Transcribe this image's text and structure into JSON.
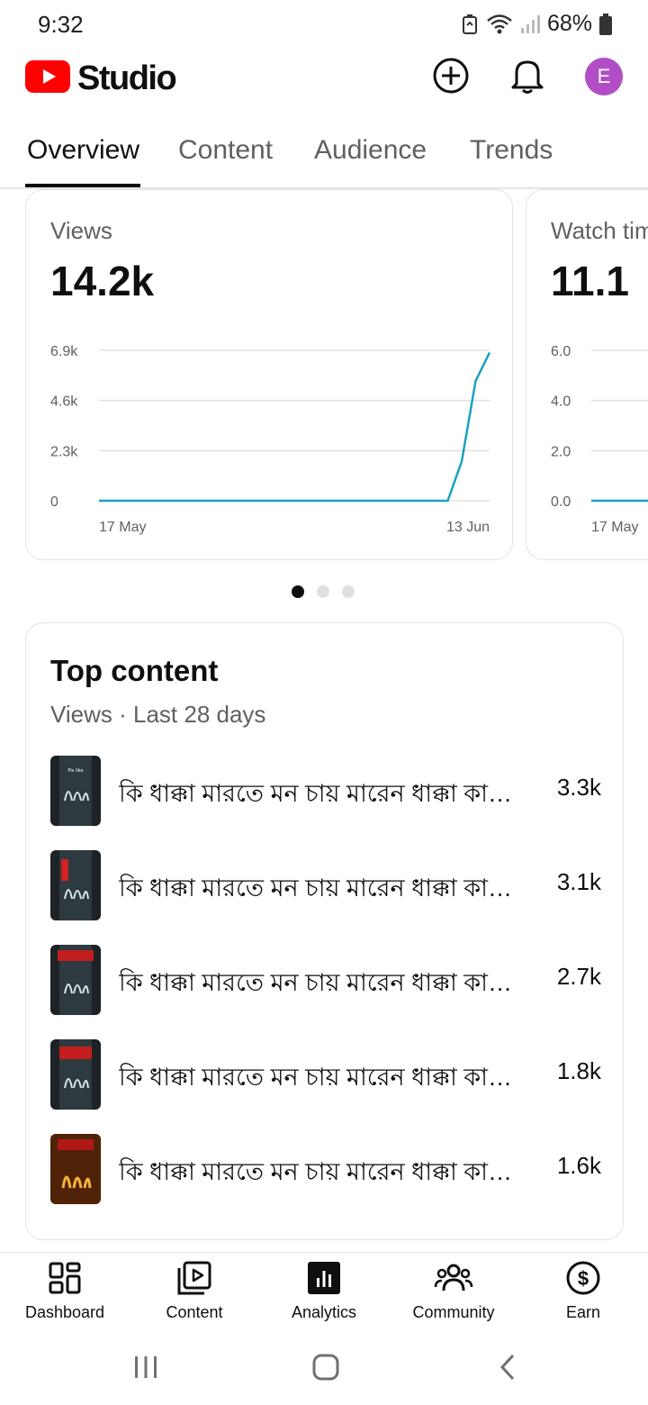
{
  "status_bar": {
    "time": "9:32",
    "battery": "68%"
  },
  "header": {
    "app_name": "Studio",
    "avatar_initial": "E"
  },
  "tabs": [
    {
      "label": "Overview",
      "active": true
    },
    {
      "label": "Content",
      "active": false
    },
    {
      "label": "Audience",
      "active": false
    },
    {
      "label": "Trends",
      "active": false
    }
  ],
  "metrics": [
    {
      "label": "Views",
      "value": "14.2k",
      "y_ticks": [
        "0",
        "2.3k",
        "4.6k",
        "6.9k"
      ],
      "x_ticks": [
        "17 May",
        "13 Jun"
      ]
    },
    {
      "label": "Watch time (hours)",
      "value": "11.1",
      "y_ticks": [
        "0.0",
        "2.0",
        "4.0",
        "6.0"
      ],
      "x_ticks": [
        "17 May"
      ]
    }
  ],
  "chart_data": [
    {
      "type": "line",
      "title": "Views",
      "x_start": "17 May",
      "x_end": "13 Jun",
      "ylim": [
        0,
        6900
      ],
      "y_ticks": [
        0,
        2300,
        4600,
        6900
      ],
      "series": [
        {
          "color": "#19a2c1",
          "values": [
            0,
            0,
            0,
            0,
            0,
            0,
            0,
            0,
            0,
            0,
            0,
            0,
            0,
            0,
            0,
            0,
            0,
            0,
            0,
            0,
            0,
            0,
            0,
            0,
            0,
            0,
            1800,
            5500,
            6800
          ]
        }
      ]
    },
    {
      "type": "line",
      "title": "Watch time",
      "x_start": "17 May",
      "ylim": [
        0,
        6.0
      ],
      "y_ticks": [
        0,
        2.0,
        4.0,
        6.0
      ],
      "series": [
        {
          "color": "#19a2c1",
          "values": [
            0,
            0,
            0
          ]
        }
      ]
    }
  ],
  "pager": {
    "count": 3,
    "active_index": 0
  },
  "top_content": {
    "title": "Top content",
    "subtitle": "Views · Last 28 days",
    "items": [
      {
        "title": "কি ধাক্কা মারতে মন চায় মারেন ধাক্কা কারো কিছু যায় আসেনা",
        "views": "3.3k",
        "thumb_icon": "allah-calligraphy-thumbnail"
      },
      {
        "title": "কি ধাক্কা মারতে মন চায় মারেন ধাক্কা কারো কিছু যায় আসেনা",
        "views": "3.1k",
        "thumb_icon": "allah-calligraphy-thumbnail"
      },
      {
        "title": "কি ধাক্কা মারতে মন চায় মারেন ধাক্কা কারো কিছু যায় আসেনা",
        "views": "2.7k",
        "thumb_icon": "allah-calligraphy-thumbnail"
      },
      {
        "title": "কি ধাক্কা মারতে মন চায় মারেন ধাক্কা কারো কিছু যায় আসেনা",
        "views": "1.8k",
        "thumb_icon": "allah-calligraphy-thumbnail"
      },
      {
        "title": "কি ধাক্কা মারতে মন চায় মারেন ধাক্কা কারো কিছু যায় আসেনা",
        "views": "1.6k",
        "thumb_icon": "allah-gold-calligraphy-thumbnail"
      }
    ]
  },
  "bottom_nav": [
    {
      "label": "Dashboard",
      "icon": "dashboard-icon"
    },
    {
      "label": "Content",
      "icon": "content-icon"
    },
    {
      "label": "Analytics",
      "icon": "analytics-icon",
      "active": true
    },
    {
      "label": "Community",
      "icon": "community-icon"
    },
    {
      "label": "Earn",
      "icon": "earn-icon"
    }
  ],
  "colors": {
    "brand_red": "#ff0000",
    "chart_line": "#19a2c1",
    "avatar_bg": "#b24ec5"
  }
}
